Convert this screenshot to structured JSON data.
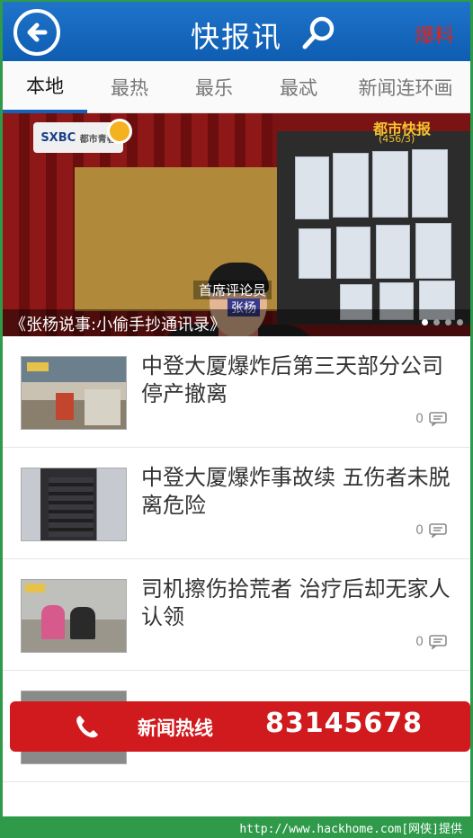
{
  "header": {
    "title": "快报讯",
    "report_label": "爆料",
    "back_icon": "back-arrow-icon",
    "search_icon": "search-icon"
  },
  "tabs": [
    {
      "label": "本地",
      "active": true
    },
    {
      "label": "最热",
      "active": false
    },
    {
      "label": "最乐",
      "active": false
    },
    {
      "label": "最忒",
      "active": false
    },
    {
      "label": "新闻连环画",
      "active": false
    }
  ],
  "banner": {
    "caption": "《张杨说事:小偷手抄通讯录》",
    "channel_logo": "SXBC",
    "channel_sub": "都市青春",
    "corner_label": "都市快报",
    "corner_sub": "(456/3)",
    "name_plate_title": "首席评论员",
    "name_plate_name": "张杨",
    "slide_count": 4,
    "active_slide": 0
  },
  "news": [
    {
      "title": "中登大厦爆炸后第三天部分公司停产撤离",
      "comments": "0"
    },
    {
      "title": "中登大厦爆炸事故续 五伤者未脱离危险",
      "comments": "0"
    },
    {
      "title": "司机擦伤拾荒者 治疗后却无家人认领",
      "comments": "0"
    }
  ],
  "hotline": {
    "label": "新闻热线",
    "number": "83145678"
  },
  "footer": {
    "watermark": "http://www.hackhome.com[网侠]提供"
  },
  "colors": {
    "header_blue": "#1463b8",
    "hotline_red": "#d01a1e",
    "frame_green": "#2f9b4a"
  }
}
